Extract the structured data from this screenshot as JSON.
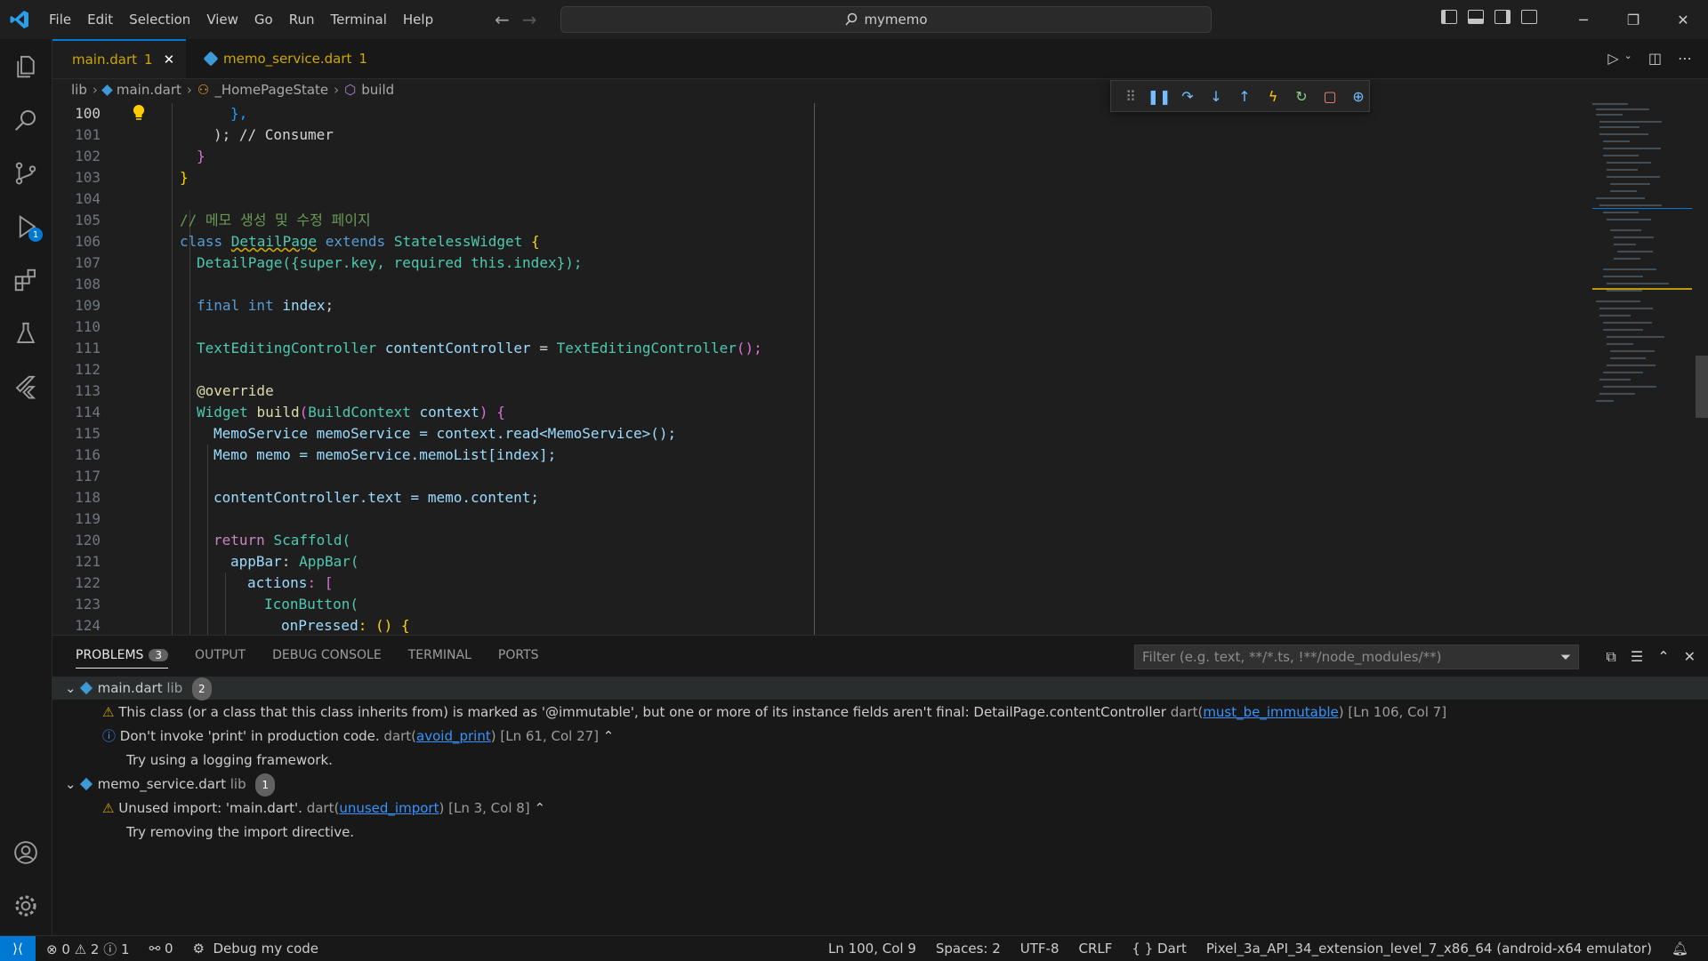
{
  "menu": [
    "File",
    "Edit",
    "Selection",
    "View",
    "Go",
    "Run",
    "Terminal",
    "Help"
  ],
  "search_text": "mymemo",
  "tabs": [
    {
      "name": "main.dart",
      "problems": "1",
      "active": true
    },
    {
      "name": "memo_service.dart",
      "problems": "1",
      "active": false
    }
  ],
  "breadcrumb": [
    "lib",
    "main.dart",
    "_HomePageState",
    "build"
  ],
  "debug_badge": "1",
  "code": {
    "ln": [
      "100",
      "101",
      "102",
      "103",
      "104",
      "105",
      "106",
      "107",
      "108",
      "109",
      "110",
      "111",
      "112",
      "113",
      "114",
      "115",
      "116",
      "117",
      "118",
      "119",
      "120",
      "121",
      "122",
      "123",
      "124"
    ]
  },
  "code_text": {
    "l100": "},",
    "l101": "); // Consumer",
    "l102": "}",
    "l103": "}",
    "l105": "// 메모 생성 및 수정 페이지",
    "l106a": "class ",
    "l106b": "DetailPage",
    "l106c": " extends ",
    "l106d": "StatelessWidget",
    "l106e": " {",
    "l107": "DetailPage({super.key, required this.index});",
    "l109a": "final int ",
    "l109b": "index",
    "l111a": "TextEditingController ",
    "l111b": "contentController",
    "l111c": " = ",
    "l111d": "TextEditingController",
    "l111e": "();",
    "l113": "@override",
    "l114a": "Widget ",
    "l114b": "build",
    "l114c": "(",
    "l114d": "BuildContext ",
    "l114e": "context",
    "l114f": ") {",
    "l115": "MemoService memoService = context.read<MemoService>();",
    "l116": "Memo memo = memoService.memoList[index];",
    "l118": "contentController.text = memo.content;",
    "l120a": "return ",
    "l120b": "Scaffold(",
    "l121a": "appBar",
    "l121b": ": ",
    "l121c": "AppBar(",
    "l122a": "actions",
    "l122b": ": [",
    "l123": "IconButton(",
    "l124a": "onPressed",
    "l124b": ": () {"
  },
  "panel": {
    "tabs": [
      "PROBLEMS",
      "OUTPUT",
      "DEBUG CONSOLE",
      "TERMINAL",
      "PORTS"
    ],
    "problems_count": "3",
    "filter_placeholder": "Filter (e.g. text, **/*.ts, !**/node_modules/**)",
    "groups": [
      {
        "file": "main.dart",
        "folder": "lib",
        "count": "2"
      },
      {
        "file": "memo_service.dart",
        "folder": "lib",
        "count": "1"
      }
    ],
    "items": [
      {
        "msg": "This class (or a class that this class inherits from) is marked as '@immutable', but one or more of its instance fields aren't final: DetailPage.contentController",
        "src": "dart(",
        "code": "must_be_immutable",
        "end": ")",
        "loc": "[Ln 106, Col 7]"
      },
      {
        "msg": "Don't invoke 'print' in production code.",
        "src": "dart(",
        "code": "avoid_print",
        "end": ")",
        "loc": "[Ln 61, Col 27]",
        "hint": "Try using a logging framework."
      },
      {
        "msg": "Unused import: 'main.dart'.",
        "src": "dart(",
        "code": "unused_import",
        "end": ")",
        "loc": "[Ln 3, Col 8]",
        "hint": "Try removing the import directive."
      }
    ]
  },
  "status": {
    "errors": "0",
    "warnings": "2",
    "infos": "1",
    "ports": "0",
    "debug": "Debug my code",
    "position": "Ln 100, Col 9",
    "spaces": "Spaces: 2",
    "encoding": "UTF-8",
    "eol": "CRLF",
    "lang": "Dart",
    "device": "Pixel_3a_API_34_extension_level_7_x86_64 (android-x64 emulator)"
  }
}
